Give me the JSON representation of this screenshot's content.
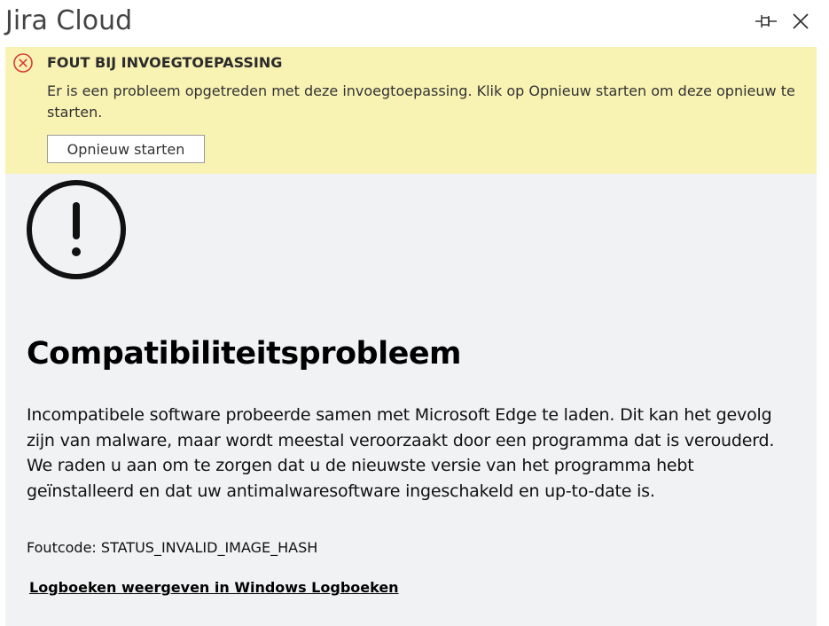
{
  "window": {
    "title": "Jira Cloud",
    "pin_icon": "pin-icon",
    "close_icon": "close-icon"
  },
  "banner": {
    "icon": "error-circle-icon",
    "title": "FOUT BIJ INVOEGTOEPASSING",
    "message": "Er is een probleem opgetreden met deze invoegtoepassing. Klik op Opnieuw starten om deze opnieuw te starten.",
    "restart_label": "Opnieuw starten",
    "background_color": "#f8f2b3",
    "icon_color": "#d83b3b"
  },
  "content": {
    "icon": "exclamation-circle-icon",
    "heading": "Compatibiliteitsprobleem",
    "description": "Incompatibele software probeerde samen met Microsoft Edge te laden. Dit kan het gevolg zijn van malware, maar wordt meestal veroorzaakt door een programma dat is verouderd. We raden u aan om te zorgen dat u de nieuwste versie van het programma hebt geïnstalleerd en dat uw antimalwaresoftware ingeschakeld en up-to-date is.",
    "error_code_label": "Foutcode:",
    "error_code_value": "STATUS_INVALID_IMAGE_HASH",
    "log_link": "Logboeken weergeven in Windows Logboeken",
    "background_color": "#f1f2f4"
  }
}
